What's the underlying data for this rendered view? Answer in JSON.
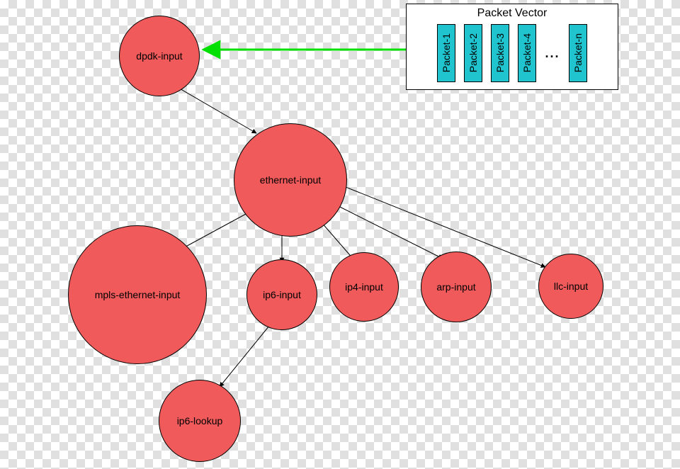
{
  "diagram": {
    "packet_vector_title": "Packet Vector",
    "packets": [
      "Packet-1",
      "Packet-2",
      "Packet-3",
      "Packet-4",
      "Packet-n"
    ],
    "ellipsis": "...",
    "nodes": {
      "dpdk": "dpdk-input",
      "ethernet": "ethernet-input",
      "mpls": "mpls-ethernet-input",
      "ip6": "ip6-input",
      "ip4": "ip4-input",
      "arp": "arp-input",
      "llc": "llc-input",
      "ip6lookup": "ip6-lookup"
    },
    "colors": {
      "node_fill": "#f05a5a",
      "packet_fill": "#1fc4cf",
      "arrow_green": "#00e000"
    },
    "edges": [
      {
        "from": "dpdk",
        "to": "ethernet"
      },
      {
        "from": "ethernet",
        "to": "mpls"
      },
      {
        "from": "ethernet",
        "to": "ip6"
      },
      {
        "from": "ethernet",
        "to": "ip4"
      },
      {
        "from": "ethernet",
        "to": "arp"
      },
      {
        "from": "ethernet",
        "to": "llc"
      },
      {
        "from": "ip6",
        "to": "ip6lookup"
      },
      {
        "from": "packet_vector",
        "to": "dpdk",
        "color": "green"
      }
    ]
  }
}
